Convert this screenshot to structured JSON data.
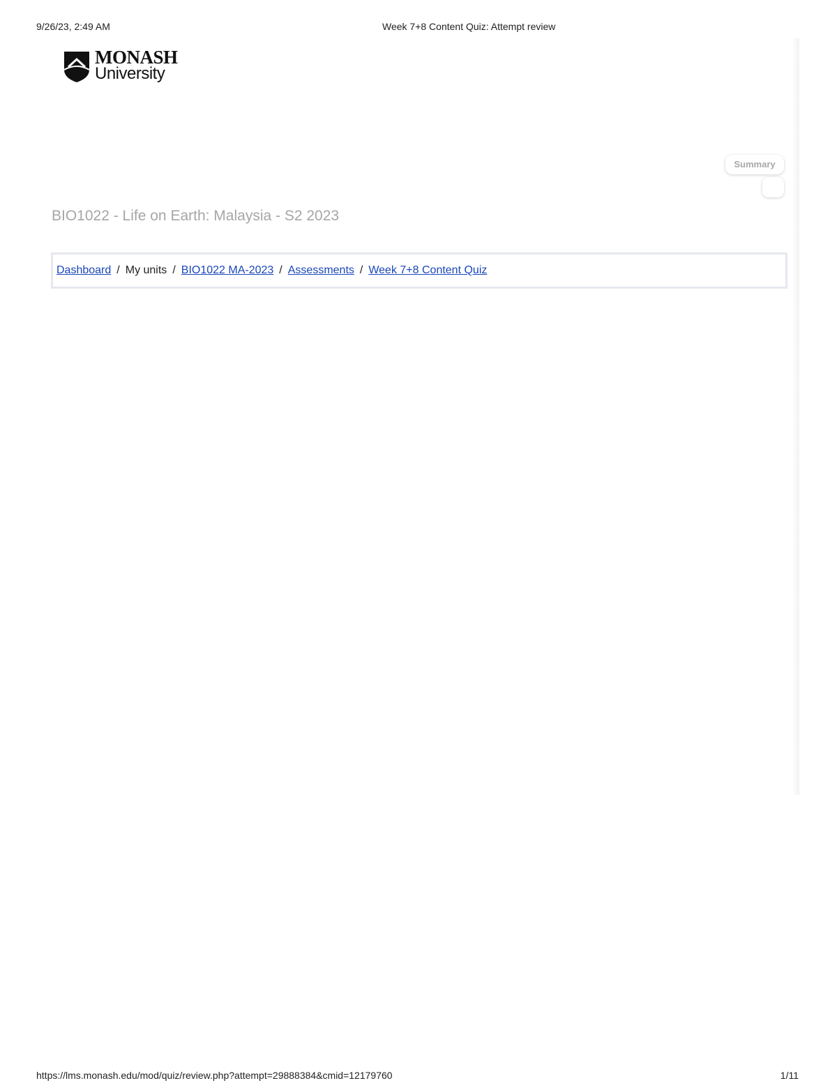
{
  "print_header": {
    "date": "9/26/23, 2:49 AM",
    "title": "Week 7+8 Content Quiz: Attempt review"
  },
  "logo": {
    "name": "MONASH",
    "sub": "University"
  },
  "summary": {
    "label": "Summary"
  },
  "course": {
    "title": "BIO1022 - Life on Earth: Malaysia - S2 2023"
  },
  "breadcrumb": {
    "items": [
      {
        "label": "Dashboard",
        "link": true
      },
      {
        "label": "My units",
        "link": false
      },
      {
        "label": "BIO1022 MA-2023",
        "link": true
      },
      {
        "label": "Assessments",
        "link": true
      },
      {
        "label": "Week 7+8 Content Quiz",
        "link": true
      }
    ],
    "separator": "/"
  },
  "print_footer": {
    "url": "https://lms.monash.edu/mod/quiz/review.php?attempt=29888384&cmid=12179760",
    "page": "1/11"
  },
  "colors": {
    "link": "#1a47b8",
    "muted_title": "#a6a6a6",
    "breadcrumb_border": "#e6e8ee"
  }
}
